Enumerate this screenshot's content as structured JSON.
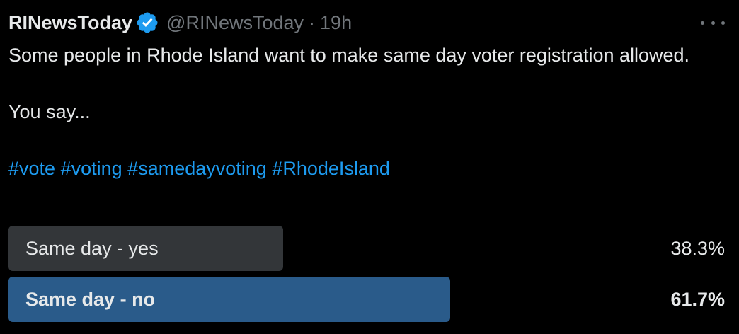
{
  "tweet": {
    "author_name": "RINewsToday",
    "verified_icon": "verified-badge-icon",
    "handle": "@RINewsToday",
    "separator": "·",
    "time": "19h",
    "more_icon": "more-options-icon",
    "text_line1": "Some people in Rhode Island want to make same day voter registration allowed.",
    "text_line2": "You say...",
    "hashtags": [
      "#vote",
      "#voting",
      "#samedayvoting",
      "#RhodeIsland"
    ]
  },
  "poll": {
    "options": [
      {
        "label": "Same day - yes",
        "percent_text": "38.3%",
        "percent": 38.3,
        "winner": false
      },
      {
        "label": "Same day - no",
        "percent_text": "61.7%",
        "percent": 61.7,
        "winner": true
      }
    ]
  },
  "colors": {
    "background": "#000000",
    "text": "#e7e9ea",
    "muted": "#71767b",
    "link": "#1d9bf0",
    "verified": "#1d9bf0",
    "poll_bar": "#333639",
    "poll_bar_winner": "#2a5b8a"
  }
}
